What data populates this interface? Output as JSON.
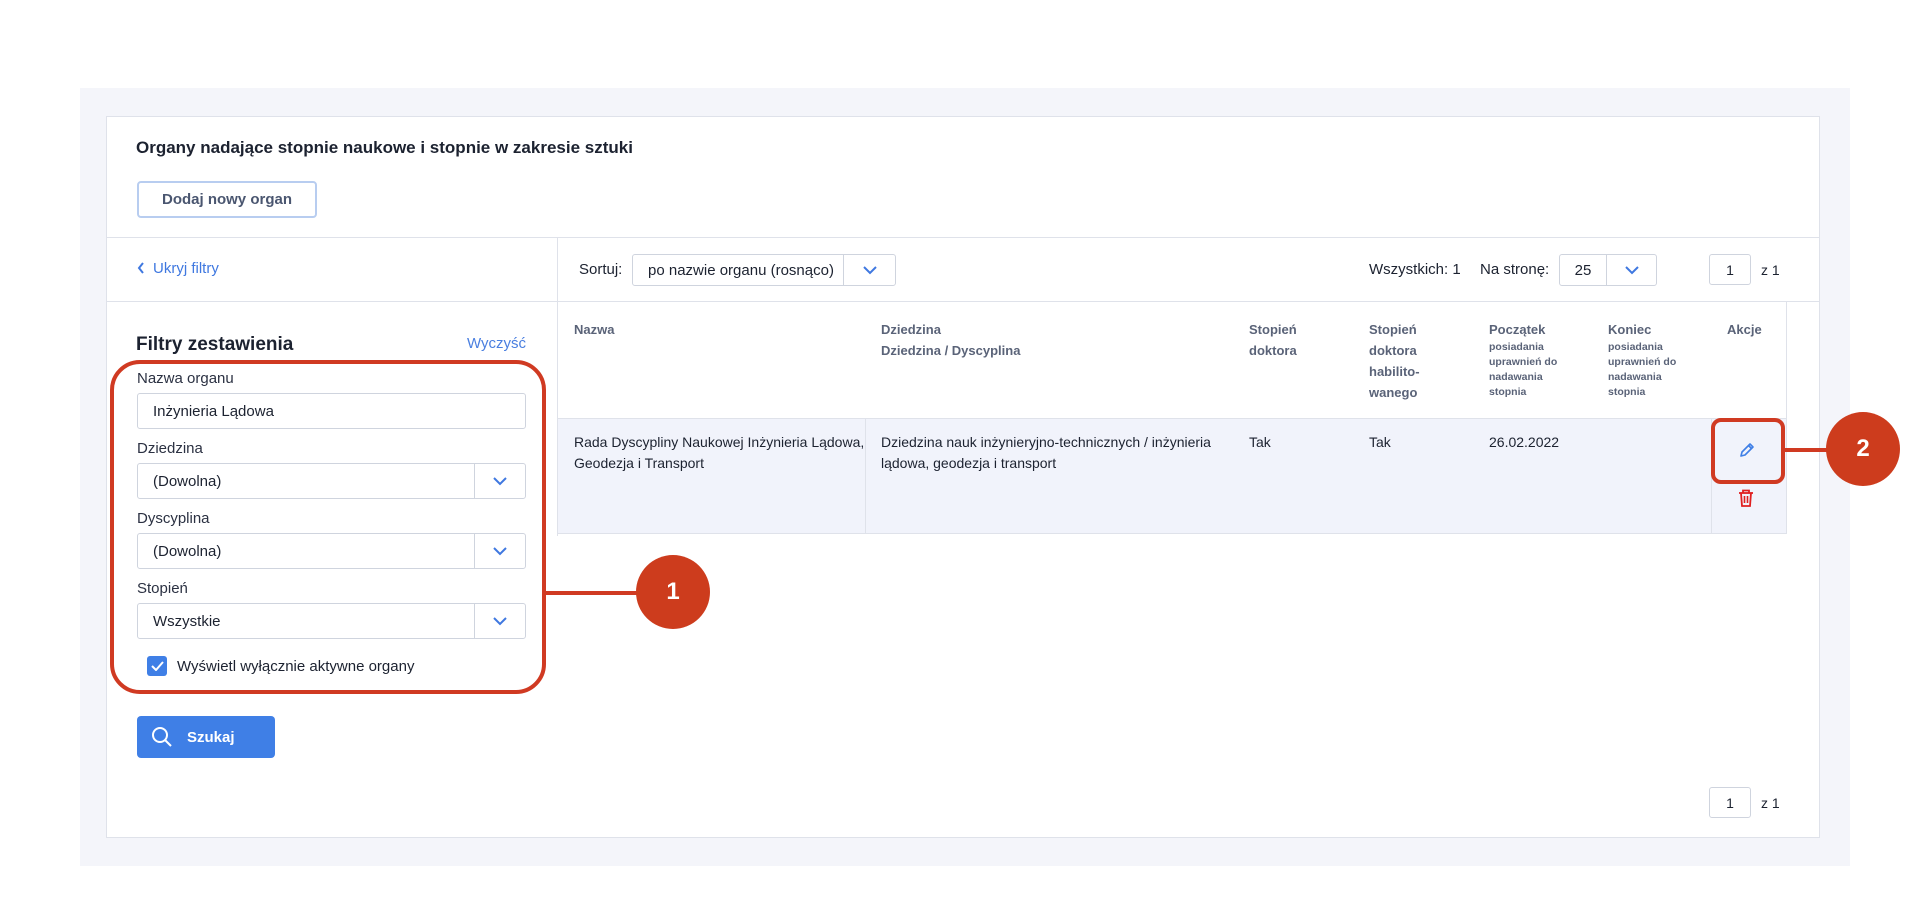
{
  "header": {
    "title": "Organy nadające stopnie naukowe i stopnie w zakresie sztuki",
    "add_button": "Dodaj nowy organ"
  },
  "filters": {
    "hide_link": "Ukryj filtry",
    "title": "Filtry zestawienia",
    "clear_link": "Wyczyść",
    "name_label": "Nazwa organu",
    "name_value": "Inżynieria Lądowa",
    "field_label": "Dziedzina",
    "field_value": "(Dowolna)",
    "discipline_label": "Dyscyplina",
    "discipline_value": "(Dowolna)",
    "degree_label": "Stopień",
    "degree_value": "Wszystkie",
    "active_only_label": "Wyświetl wyłącznie aktywne organy",
    "active_only_checked": true,
    "search_button": "Szukaj"
  },
  "toolbar": {
    "sort_label": "Sortuj:",
    "sort_value": "po nazwie organu (rosnąco)",
    "total_text": "Wszystkich: 1",
    "per_page_label": "Na stronę:",
    "per_page_value": "25",
    "page_current": "1",
    "page_of": "z  1"
  },
  "table": {
    "headers": {
      "name": "Nazwa",
      "field_line1": "Dziedzina",
      "field_line2": "Dziedzina / Dyscyplina",
      "doctor_line1": "Stopień",
      "doctor_line2": "doktora",
      "habil_line1": "Stopień",
      "habil_line2": "doktora",
      "habil_line3": "habilito-",
      "habil_line4": "wanego",
      "start_title": "Początek",
      "start_sub1": "posiadania",
      "start_sub2": "uprawnień do",
      "start_sub3": "nadawania",
      "start_sub4": "stopnia",
      "end_title": "Koniec",
      "end_sub1": "posiadania",
      "end_sub2": "uprawnień do",
      "end_sub3": "nadawania",
      "end_sub4": "stopnia",
      "actions": "Akcje"
    },
    "rows": [
      {
        "name_line1": "Rada Dyscypliny Naukowej Inżynieria Lądowa,",
        "name_line2": "Geodezja i Transport",
        "field_line1": "Dziedzina nauk inżynieryjno-technicznych / inżynieria",
        "field_line2": "lądowa, geodezja i transport",
        "doctor": "Tak",
        "habil": "Tak",
        "start": "26.02.2022",
        "end": ""
      }
    ]
  },
  "bottom_pagination": {
    "page_current": "1",
    "page_of": "z  1"
  },
  "callouts": {
    "badge1": "1",
    "badge2": "2"
  },
  "colors": {
    "accent": "#3f7fe6",
    "callout": "#d03a22",
    "row_highlight": "#f1f3fb",
    "delete": "#e02020"
  },
  "icons": [
    "chevron-left-icon",
    "chevron-down-icon",
    "check-icon",
    "search-icon",
    "pencil-icon",
    "trash-icon"
  ]
}
